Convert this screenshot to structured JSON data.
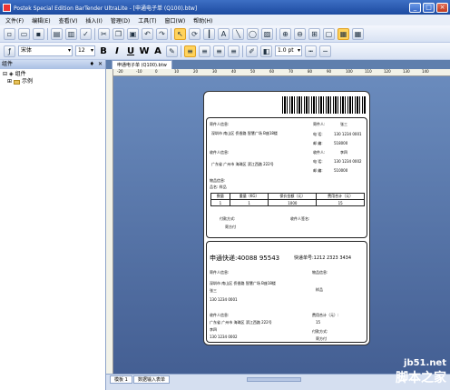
{
  "window": {
    "title": "Postek Special Edition BarTender UltraLite - [申通电子单 (Q100).btw]"
  },
  "menu": [
    "文件(F)",
    "编辑(E)",
    "查看(V)",
    "插入(I)",
    "管理(D)",
    "工具(T)",
    "窗口(W)",
    "帮助(H)"
  ],
  "toolbar2": {
    "font": "宋体",
    "size": "12",
    "bold": "B",
    "italic": "I",
    "underline": "U",
    "wide": "W",
    "letter": "A",
    "line_width": "1.0 pt"
  },
  "left_panel": {
    "title": "组件",
    "pin": "♦",
    "close": "✕",
    "root": "组件",
    "child": "示例"
  },
  "doc_tab": "申通电子单 (Q100).btw",
  "ruler_labels": [
    "-20",
    "-10",
    "0",
    "10",
    "20",
    "30",
    "40",
    "50",
    "60",
    "70",
    "80",
    "90",
    "100",
    "110",
    "120",
    "130",
    "140"
  ],
  "sheet_tabs": [
    "模板 1",
    "数据输入表单"
  ],
  "label": {
    "sender_title": "寄件人信息:",
    "sender_addr": "深圳市  南山区  侨香路  智慧广场  B座18楼",
    "sender_name_label": "寄件人:",
    "sender_name": "张三",
    "sender_phone_label": "电  话:",
    "sender_phone": "130  1234  0001",
    "sender_zip_label": "邮  编:",
    "sender_zip": "518000",
    "recv_title": "收件人信息:",
    "recv_addr": "广东省   广州市   海珠区  滨江西路  222号",
    "recv_name_label": "收件人:",
    "recv_name": "李四",
    "recv_phone_label": "电  话:",
    "recv_phone": "130  1234  0002",
    "recv_zip_label": "邮  编:",
    "recv_zip": "510000",
    "goods_title": "物品信息:",
    "goods_name": "品名:    样品",
    "table_headers": [
      "数量",
      "重量（KG）",
      "保价金额（元）",
      "费用合计（元）"
    ],
    "table_values": [
      "1",
      "1",
      "1000",
      "15"
    ],
    "pay_label": "付款方式:",
    "pay_value": "寄方付",
    "recv_sign": "收件人签名:",
    "company": "申通快递:40088  95543",
    "tracking": "快递单号:1212  2323  3434",
    "s2_sender_title": "寄件人信息:",
    "s2_sender_addr": "深圳市  南山区  侨香路  智慧广场  B座18楼",
    "s2_sender_name": "张三",
    "s2_sender_phone": "130  1234  0001",
    "s2_goods_title": "物品信息:",
    "s2_goods": "样品",
    "s2_recv_title": "收件人信息:",
    "s2_recv_addr": "广东省   广州市   海珠区  滨江西路  222号",
    "s2_recv_name": "李四",
    "s2_recv_phone": "130  1234  0002",
    "s2_fee_label": "费用合计（元）:",
    "s2_fee": "15",
    "s2_pay_label": "付款方式:",
    "s2_pay": "寄方付"
  },
  "watermark": {
    "line1": "jb51.net",
    "line2": "脚本之家"
  }
}
